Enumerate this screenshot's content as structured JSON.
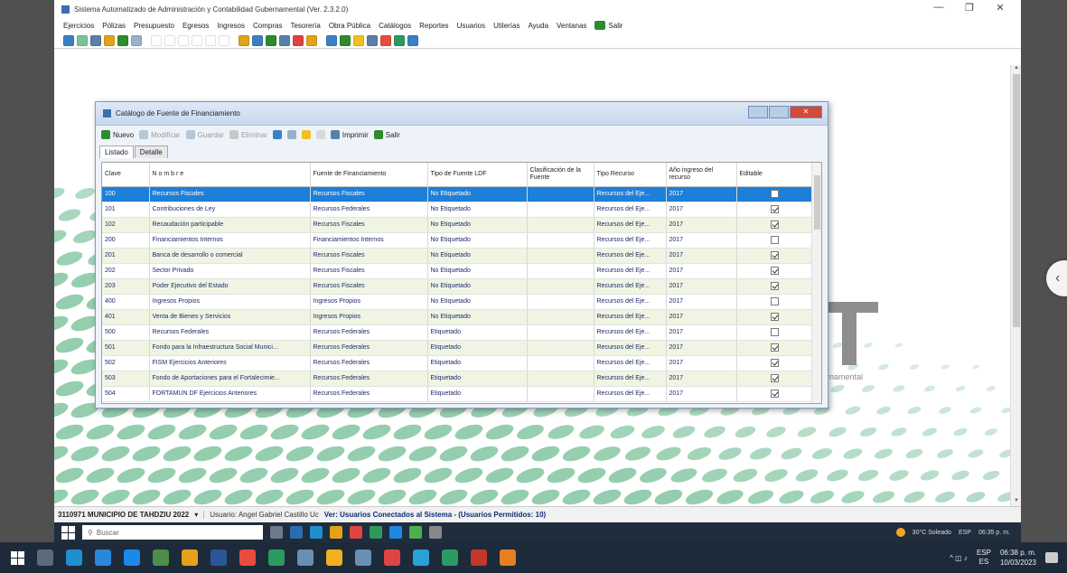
{
  "window": {
    "title": "Sistema Automatizado de Administración y Contabilidad Gubernamental (Ver. 2.3.2.0)",
    "controls": [
      "—",
      "❐",
      "✕"
    ]
  },
  "menu": [
    "Ejercicios",
    "Pólizas",
    "Presupuesto",
    "Egresos",
    "Ingresos",
    "Compras",
    "Tesorería",
    "Obra Pública",
    "Catálogos",
    "Reportes",
    "Usuarios",
    "Utilerías",
    "Ayuda",
    "Ventanas"
  ],
  "menu_exit": "Salir",
  "dialog": {
    "title": "Catálogo de Fuente de Financiamiento",
    "toolbar": {
      "nuevo": "Nuevo",
      "modificar": "Modificar",
      "guardar": "Guardar",
      "eliminar": "Eliminar",
      "imprimir": "Imprimir",
      "salir": "Salir"
    },
    "tabs": [
      "Listado",
      "Detalle"
    ],
    "columns": [
      "Clave",
      "N o m b r e",
      "Fuente de Financiamiento",
      "Tipo de Fuente LDF",
      "Clasificación de la Fuente",
      "Tipo Recurso",
      "Año ingreso del recurso",
      "Editable"
    ],
    "rows": [
      {
        "clave": "100",
        "nombre": "Recursos Fiscales",
        "fuente": "Recursos Fiscales",
        "tipo_ldf": "No Etiquetado",
        "clasif": "",
        "tipo_rec": "Recursos del Eje...",
        "anio": "2017",
        "editable": false
      },
      {
        "clave": "101",
        "nombre": "Contribuciones de Ley",
        "fuente": "Recursos Federales",
        "tipo_ldf": "No Etiquetado",
        "clasif": "",
        "tipo_rec": "Recursos del Eje...",
        "anio": "2017",
        "editable": true
      },
      {
        "clave": "102",
        "nombre": "Recaudación participable",
        "fuente": "Recursos Fiscales",
        "tipo_ldf": "No Etiquetado",
        "clasif": "",
        "tipo_rec": "Recursos del Eje...",
        "anio": "2017",
        "editable": true
      },
      {
        "clave": "200",
        "nombre": "Financiamientos Internos",
        "fuente": "Financiamientos Internos",
        "tipo_ldf": "No Etiquetado",
        "clasif": "",
        "tipo_rec": "Recursos del Eje...",
        "anio": "2017",
        "editable": false
      },
      {
        "clave": "201",
        "nombre": "Banca de desarrollo o comercial",
        "fuente": "Recursos Fiscales",
        "tipo_ldf": "No Etiquetado",
        "clasif": "",
        "tipo_rec": "Recursos del Eje...",
        "anio": "2017",
        "editable": true
      },
      {
        "clave": "202",
        "nombre": "Sector Privado",
        "fuente": "Recursos Fiscales",
        "tipo_ldf": "No Etiquetado",
        "clasif": "",
        "tipo_rec": "Recursos del Eje...",
        "anio": "2017",
        "editable": true
      },
      {
        "clave": "203",
        "nombre": "Poder Ejecutivo del Estado",
        "fuente": "Recursos Fiscales",
        "tipo_ldf": "No Etiquetado",
        "clasif": "",
        "tipo_rec": "Recursos del Eje...",
        "anio": "2017",
        "editable": true
      },
      {
        "clave": "400",
        "nombre": "Ingresos Propios",
        "fuente": "Ingresos Propios",
        "tipo_ldf": "No Etiquetado",
        "clasif": "",
        "tipo_rec": "Recursos del Eje...",
        "anio": "2017",
        "editable": false
      },
      {
        "clave": "401",
        "nombre": "Venta de Bienes y Servicios",
        "fuente": "Ingresos Propios",
        "tipo_ldf": "No Etiquetado",
        "clasif": "",
        "tipo_rec": "Recursos del Eje...",
        "anio": "2017",
        "editable": true
      },
      {
        "clave": "500",
        "nombre": "Recursos Federales",
        "fuente": "Recursos Federales",
        "tipo_ldf": "Etiquetado",
        "clasif": "",
        "tipo_rec": "Recursos del Eje...",
        "anio": "2017",
        "editable": false
      },
      {
        "clave": "501",
        "nombre": "Fondo para la Infraestructura Social Munici...",
        "fuente": "Recursos Federales",
        "tipo_ldf": "Etiquetado",
        "clasif": "",
        "tipo_rec": "Recursos del Eje...",
        "anio": "2017",
        "editable": true
      },
      {
        "clave": "502",
        "nombre": "FISM Ejercicios Anteriores",
        "fuente": "Recursos Federales",
        "tipo_ldf": "Etiquetado",
        "clasif": "",
        "tipo_rec": "Recursos del Eje...",
        "anio": "2017",
        "editable": true
      },
      {
        "clave": "503",
        "nombre": "Fondo de Aportaciones para el Fortalecimie...",
        "fuente": "Recursos Federales",
        "tipo_ldf": "Etiquetado",
        "clasif": "",
        "tipo_rec": "Recursos del Eje...",
        "anio": "2017",
        "editable": true
      },
      {
        "clave": "504",
        "nombre": "FORTAMUN DF Ejercicios Anteriores",
        "fuente": "Recursos Federales",
        "tipo_ldf": "Etiquetado",
        "clasif": "",
        "tipo_rec": "Recursos del Eje...",
        "anio": "2017",
        "editable": true
      }
    ]
  },
  "background": {
    "tagline": "rnamental"
  },
  "status": {
    "municipio": "3110971 MUNICIPIO DE TAHDZIU 2022",
    "usuario": "Usuario: Angel Gabriel Castillo Uc",
    "conectados": "Ver: Usuarios Conectados al Sistema - (Usuarios Permitidos: 10)"
  },
  "inner_taskbar": {
    "search_placeholder": "Buscar",
    "weather": "30°C Soleado",
    "lang": "ESP",
    "time": "06:35 p. m."
  },
  "taskbar": {
    "lang1": "ESP",
    "lang2": "ES",
    "time": "06:38 p. m.",
    "date": "10/03/2023"
  },
  "colors": {
    "selected_row": "#1e7fd8",
    "alt_row": "#f0f5e3",
    "accent_green": "#7ac29a",
    "close_button": "#d34a3a"
  }
}
